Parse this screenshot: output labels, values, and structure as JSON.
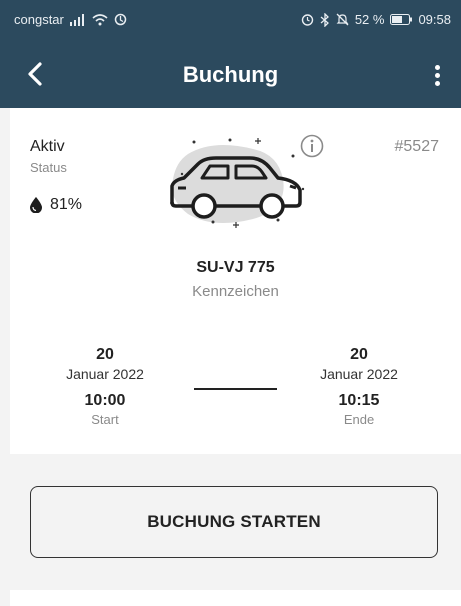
{
  "status_bar": {
    "carrier": "congstar",
    "battery": "52 %",
    "time": "09:58"
  },
  "app_bar": {
    "title": "Buchung",
    "back_icon": "chevron-left-icon",
    "menu_icon": "more-vert-icon"
  },
  "booking": {
    "status_value": "Aktiv",
    "status_label": "Status",
    "fuel_percent": "81%",
    "id": "#5527",
    "plate": "SU-VJ 775",
    "plate_label": "Kennzeichen",
    "start": {
      "day": "20",
      "month": "Januar 2022",
      "time": "10:00",
      "label": "Start"
    },
    "end": {
      "day": "20",
      "month": "Januar 2022",
      "time": "10:15",
      "label": "Ende"
    }
  },
  "actions": {
    "start_label": "BUCHUNG STARTEN"
  },
  "colors": {
    "header": "#2c4a5e",
    "background": "#f3f3f3",
    "card": "#ffffff"
  }
}
